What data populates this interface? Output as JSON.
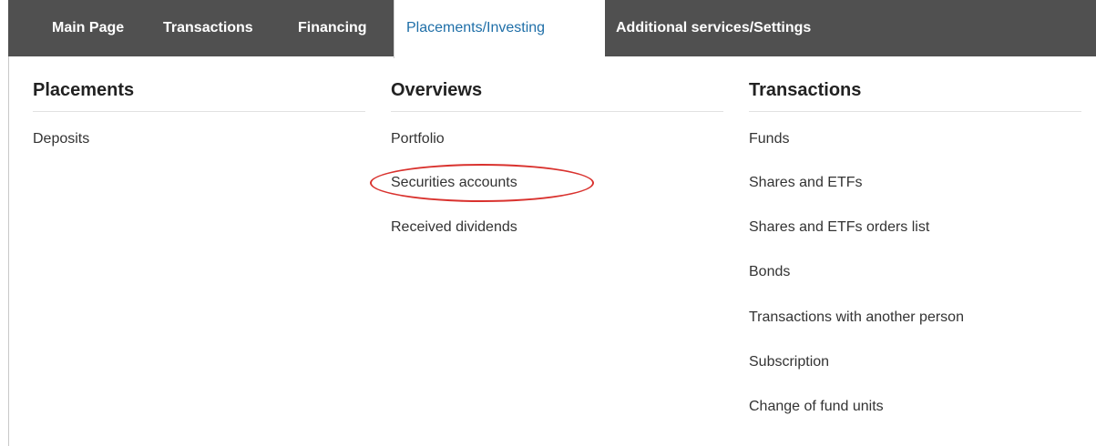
{
  "nav": {
    "tabs": [
      {
        "label": "Main Page"
      },
      {
        "label": "Transactions"
      },
      {
        "label": "Financing"
      },
      {
        "label": "Placements/Investing"
      },
      {
        "label": "Additional services/Settings"
      }
    ],
    "active_tab": "Placements/Investing"
  },
  "menu": {
    "placements": {
      "heading": "Placements",
      "items": [
        "Deposits"
      ]
    },
    "overviews": {
      "heading": "Overviews",
      "items": [
        "Portfolio",
        "Securities accounts",
        "Received dividends"
      ]
    },
    "transactions": {
      "heading": "Transactions",
      "items": [
        "Funds",
        "Shares and ETFs",
        "Shares and ETFs orders list",
        "Bonds",
        "Transactions with another person",
        "Subscription",
        "Change of fund units"
      ]
    }
  },
  "highlighted_item": "Securities accounts",
  "colors": {
    "navbar_bg": "#505050",
    "active_tab_text": "#1f6fa8",
    "highlight": "#d9322e"
  }
}
